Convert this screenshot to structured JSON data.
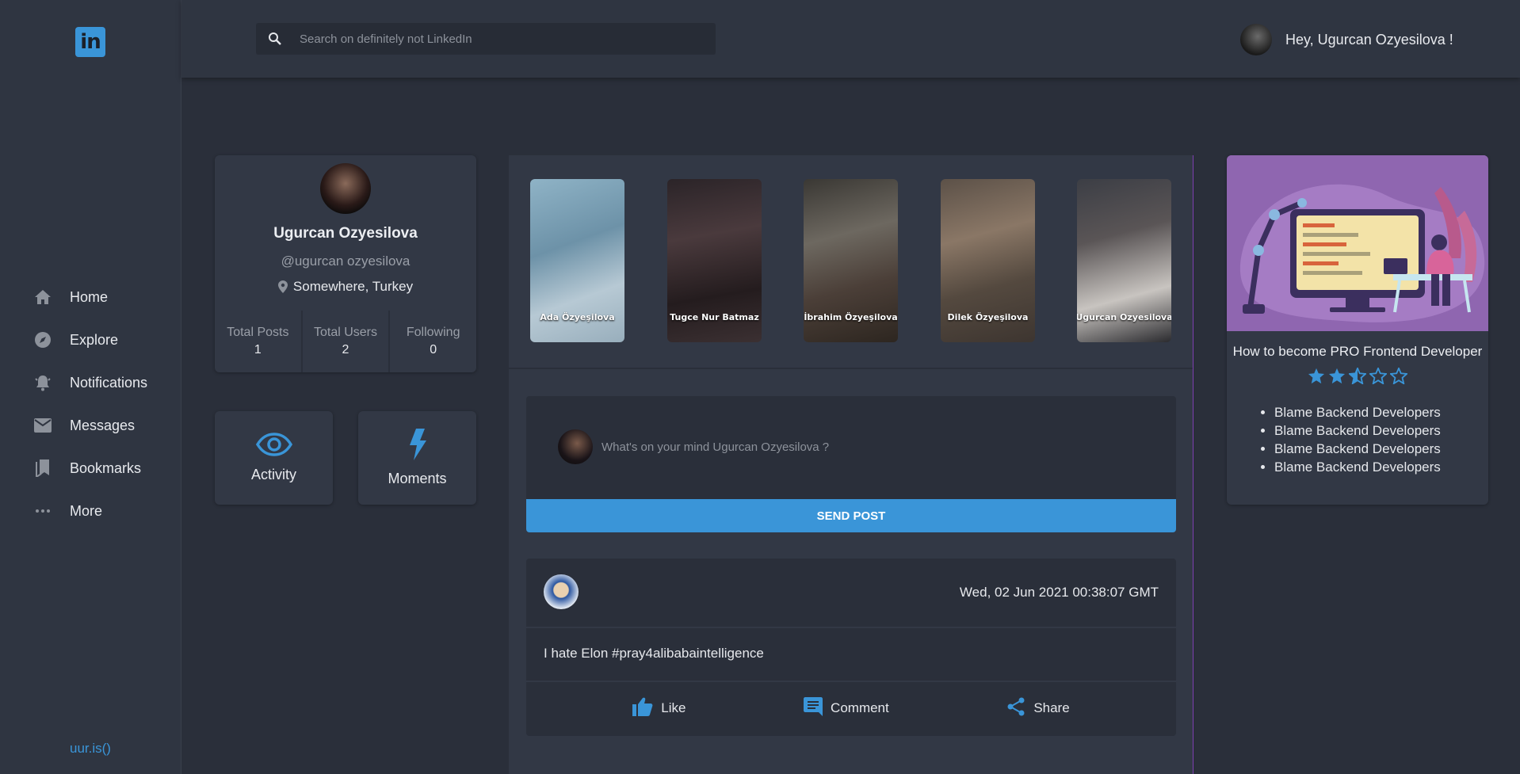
{
  "sidebar": {
    "logo": "in",
    "items": [
      {
        "label": "Home",
        "icon": "home-icon"
      },
      {
        "label": "Explore",
        "icon": "compass-icon"
      },
      {
        "label": "Notifications",
        "icon": "bell-icon"
      },
      {
        "label": "Messages",
        "icon": "mail-icon"
      },
      {
        "label": "Bookmarks",
        "icon": "bookmark-icon"
      },
      {
        "label": "More",
        "icon": "more-icon"
      }
    ],
    "footer_link": "uur.is()"
  },
  "topbar": {
    "search_placeholder": "Search on definitely not LinkedIn",
    "greeting": "Hey, Ugurcan Ozyesilova !"
  },
  "profile": {
    "name": "Ugurcan Ozyesilova",
    "handle": "@ugurcan ozyesilova",
    "location": "Somewhere, Turkey",
    "stats": [
      {
        "label": "Total Posts",
        "value": "1"
      },
      {
        "label": "Total Users",
        "value": "2"
      },
      {
        "label": "Following",
        "value": "0"
      }
    ]
  },
  "tiles": {
    "activity": "Activity",
    "moments": "Moments"
  },
  "stories": [
    {
      "name": "Ada Özyeşilova"
    },
    {
      "name": "Tugce Nur Batmaz"
    },
    {
      "name": "İbrahim Özyeşilova"
    },
    {
      "name": "Dilek Özyeşilova"
    },
    {
      "name": "Ugurcan Ozyesilova"
    }
  ],
  "composer": {
    "placeholder": "What's on your mind Ugurcan Ozyesilova ?",
    "send_label": "SEND POST"
  },
  "post": {
    "date": "Wed, 02 Jun 2021 00:38:07 GMT",
    "body": "I hate Elon #pray4alibabaintelligence",
    "actions": {
      "like": "Like",
      "comment": "Comment",
      "share": "Share"
    }
  },
  "course": {
    "title": "How to become PRO Frontend Developer",
    "rating": 2.5,
    "rating_max": 5,
    "bullets": [
      "Blame Backend Developers",
      "Blame Backend Developers",
      "Blame Backend Developers",
      "Blame Backend Developers"
    ]
  },
  "colors": {
    "accent": "#3a95d8",
    "background": "#2a2f3a",
    "panel": "#323845",
    "divider": "#7c3fb0"
  }
}
